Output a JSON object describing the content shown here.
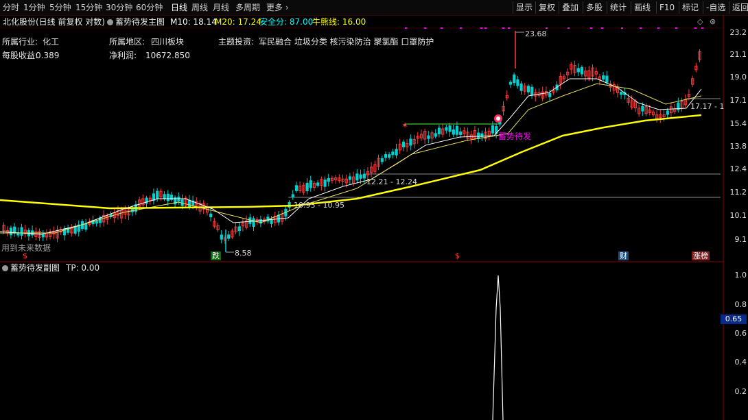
{
  "toolbar": {
    "periods": [
      "分时",
      "1分钟",
      "5分钟",
      "15分钟",
      "30分钟",
      "60分钟",
      "日线",
      "周线",
      "月线",
      "多周期",
      "更多"
    ],
    "active_period": "日线",
    "more_icon": "chevron-right-icon",
    "right_buttons": [
      "显示",
      "复权",
      "叠加",
      "多股",
      "统计",
      "画线",
      "F10",
      "标记",
      "-自选",
      "返回"
    ]
  },
  "main": {
    "stock": "北化股份(日线 前复权 对数)",
    "indicator": "蓄势待发主图",
    "m10": "M10: 18.14",
    "m20": "M20: 17.24",
    "safe": "安全分: 87.00",
    "bull": "牛熊线: 16.00",
    "info": {
      "industry_label": "所属行业:",
      "industry": "化工",
      "region_label": "所属地区:",
      "region": "四川板块",
      "theme_label": "主题投资:",
      "theme": "军民融合 垃圾分类 核污染防治 聚氯酯 口罩防护",
      "eps_label": "每股收益:",
      "eps": "0.389",
      "profit_label": "净利润:",
      "profit": "10672.850"
    },
    "annotations": {
      "high": "23.68",
      "low": "8.58",
      "range1": "12.21 - 12.24",
      "range2": "10.93 - 10.95",
      "right_label": "17.17 - 1",
      "signal": "蓄势待发",
      "future": "用到未来数据"
    },
    "badges": [
      "跌",
      "$",
      "$",
      "财",
      "涨榜"
    ],
    "y_ticks": [
      "23.2",
      "21.1",
      "19.0",
      "17.1",
      "15.4",
      "13.8",
      "12.4",
      "11.2",
      "10.1",
      "9.1"
    ],
    "colors": {
      "up": "#ff3b3b",
      "down": "#00d0d0",
      "ma_white": "#ffffff",
      "ma_yellow": "#ffff00",
      "magenta": "#ff00ff"
    }
  },
  "sub": {
    "title": "蓄势待发副图",
    "tp": "TP: 0.00",
    "y_ticks": [
      "1.0",
      "0.8",
      "0.6",
      "0.4",
      "0.2"
    ],
    "current": "0.65"
  }
}
